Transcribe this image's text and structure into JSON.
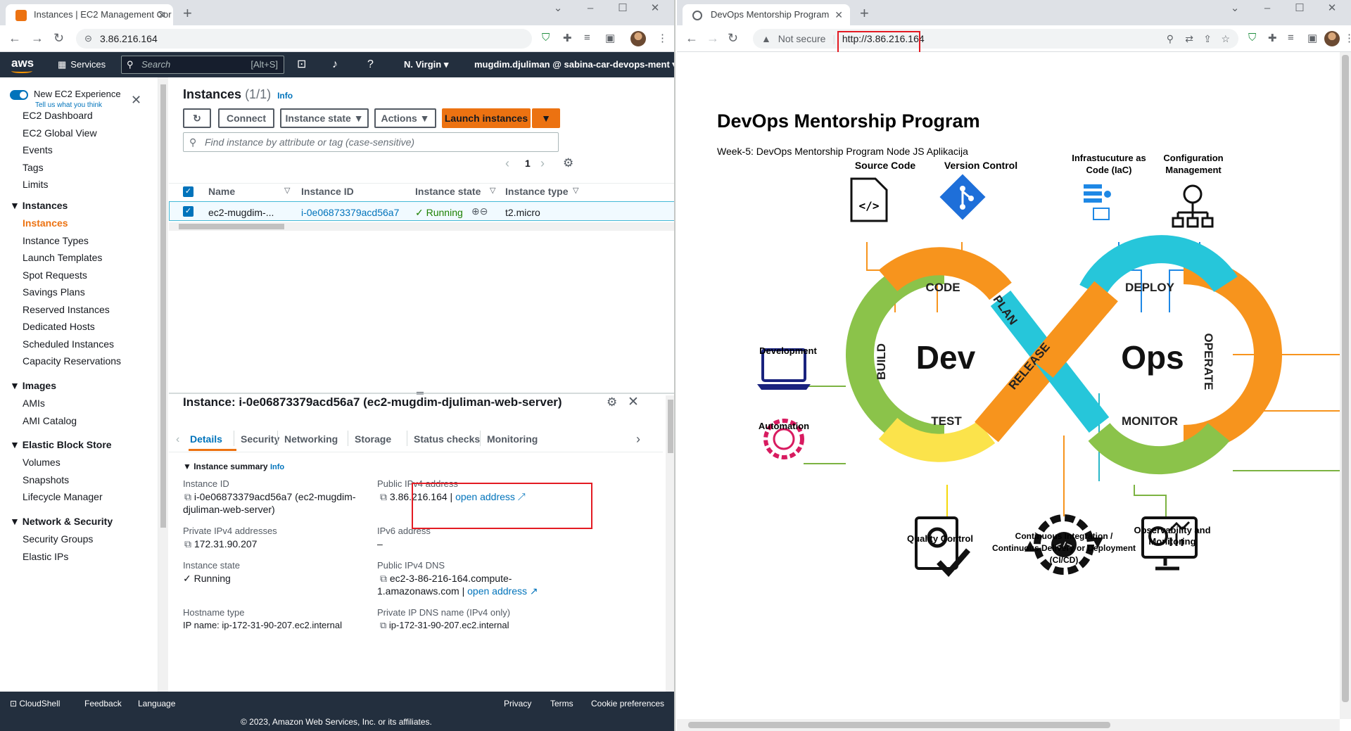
{
  "left_browser": {
    "tab_title": "Instances | EC2 Management Cor",
    "url": "3.86.216.164"
  },
  "aws_header": {
    "logo": "aws",
    "services": "Services",
    "search_placeholder": "Search",
    "search_shortcut": "[Alt+S]",
    "region": "N. Virgin",
    "account": "mugdim.djuliman @ sabina-car-devops-ment"
  },
  "sidebar": {
    "new_experience": "New EC2 Experience",
    "tell_us": "Tell us what you think",
    "items_top": [
      "EC2 Dashboard",
      "EC2 Global View",
      "Events",
      "Tags",
      "Limits"
    ],
    "instances_section": "Instances",
    "instances_items": [
      "Instances",
      "Instance Types",
      "Launch Templates",
      "Spot Requests",
      "Savings Plans",
      "Reserved Instances",
      "Dedicated Hosts",
      "Scheduled Instances",
      "Capacity Reservations"
    ],
    "images_section": "Images",
    "images_items": [
      "AMIs",
      "AMI Catalog"
    ],
    "ebs_section": "Elastic Block Store",
    "ebs_items": [
      "Volumes",
      "Snapshots",
      "Lifecycle Manager"
    ],
    "net_section": "Network & Security",
    "net_items": [
      "Security Groups",
      "Elastic IPs"
    ]
  },
  "instances_panel": {
    "title": "Instances",
    "count": "(1/1)",
    "info": "Info",
    "connect": "Connect",
    "instance_state": "Instance state",
    "actions": "Actions",
    "launch": "Launch instances",
    "filter_placeholder": "Find instance by attribute or tag (case-sensitive)",
    "page": "1",
    "columns": [
      "Name",
      "Instance ID",
      "Instance state",
      "Instance type"
    ],
    "row": {
      "name": "ec2-mugdim-...",
      "id": "i-0e06873379acd56a7",
      "state": "Running",
      "type": "t2.micro"
    }
  },
  "details": {
    "title": "Instance: i-0e06873379acd56a7 (ec2-mugdim-djuliman-web-server)",
    "tabs": [
      "Details",
      "Security",
      "Networking",
      "Storage",
      "Status checks",
      "Monitoring"
    ],
    "summary": "Instance summary",
    "info": "Info",
    "instance_id_label": "Instance ID",
    "instance_id_1": "i-0e06873379acd56a7 (ec2-mugdim-",
    "instance_id_2": "djuliman-web-server)",
    "public_ipv4_label": "Public IPv4 address",
    "public_ipv4": "3.86.216.164",
    "separator": "|",
    "open_address": "open address",
    "private_ipv4_label": "Private IPv4 addresses",
    "private_ipv4": "172.31.90.207",
    "ipv6_label": "IPv6 address",
    "ipv6": "–",
    "state_label": "Instance state",
    "state": "Running",
    "dns_label": "Public IPv4 DNS",
    "dns_1": "ec2-3-86-216-164.compute-",
    "dns_2": "1.amazonaws.com",
    "hostname_label": "Hostname type",
    "hostname": "IP name: ip-172-31-90-207.ec2.internal",
    "private_dns_label": "Private IP DNS name (IPv4 only)",
    "private_dns": "ip-172-31-90-207.ec2.internal"
  },
  "footer": {
    "cloudshell": "CloudShell",
    "feedback": "Feedback",
    "language": "Language",
    "privacy": "Privacy",
    "terms": "Terms",
    "cookies": "Cookie preferences",
    "copyright": "© 2023, Amazon Web Services, Inc. or its affiliates."
  },
  "right_browser": {
    "tab_title": "DevOps Mentorship Program",
    "not_secure": "Not secure",
    "url": "http://3.86.216.164"
  },
  "webpage": {
    "title": "DevOps Mentorship Program",
    "subtitle": "Week-5: DevOps Mentorship Program Node JS Aplikacija",
    "labels": {
      "source_code": "Source Code",
      "version_control": "Version Control",
      "iac_1": "Infrastucuture as",
      "iac_2": "Code (IaC)",
      "config_1": "Configuration",
      "config_2": "Management",
      "development": "Development",
      "automation": "Automation",
      "quality": "Quality Control",
      "ci_1": "Continuous Integration /",
      "ci_2": "Continuous Delivery or Deployment",
      "ci_3": "(CI/CD)",
      "obs_1": "Observability and",
      "obs_2": "Monitoring"
    },
    "loop": {
      "dev": "Dev",
      "ops": "Ops",
      "code": "CODE",
      "plan": "PLAN",
      "build": "BUILD",
      "test": "TEST",
      "release": "RELEASE",
      "deploy": "DEPLOY",
      "operate": "OPERATE",
      "monitor": "MONITOR"
    }
  }
}
